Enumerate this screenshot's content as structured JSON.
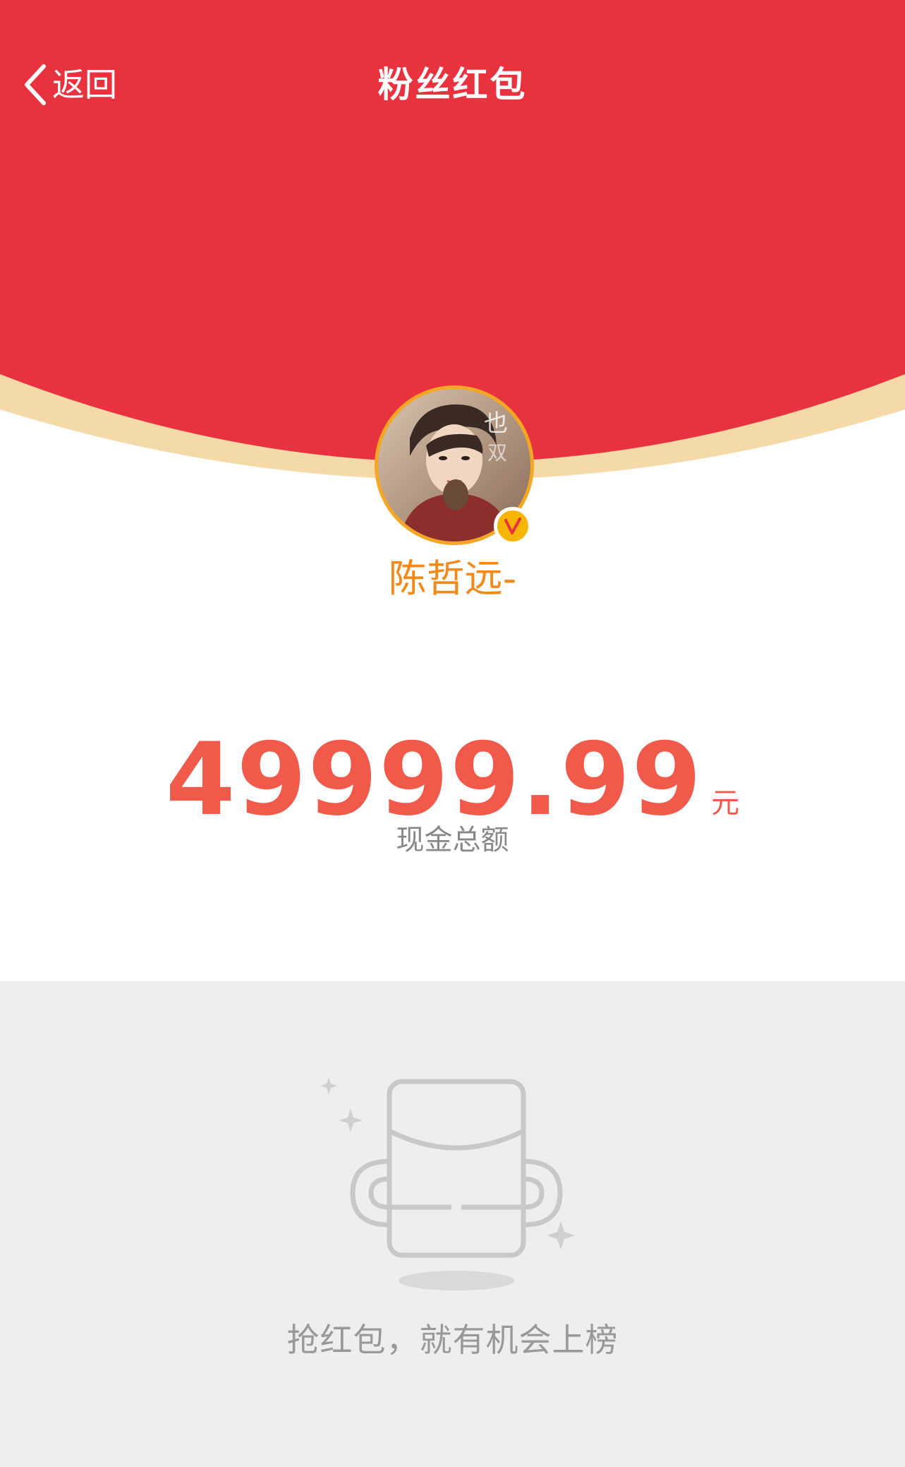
{
  "header": {
    "back_label": "返回",
    "title": "粉丝红包"
  },
  "user": {
    "name": "陈哲远-",
    "verified": true
  },
  "amount": {
    "value": "49999.99",
    "unit": "元",
    "caption": "现金总额"
  },
  "empty_state": {
    "message": "抢红包，就有机会上榜"
  },
  "colors": {
    "header_red": "#e8333f",
    "curve_gold": "#f6d9a9",
    "avatar_ring": "#f5a623",
    "username": "#f28a1b",
    "amount": "#f15a4a",
    "empty_bg": "#eeeeee"
  },
  "icons": {
    "back": "chevron-left-icon",
    "badge": "verified-v-icon",
    "empty": "red-packet-empty-icon"
  }
}
